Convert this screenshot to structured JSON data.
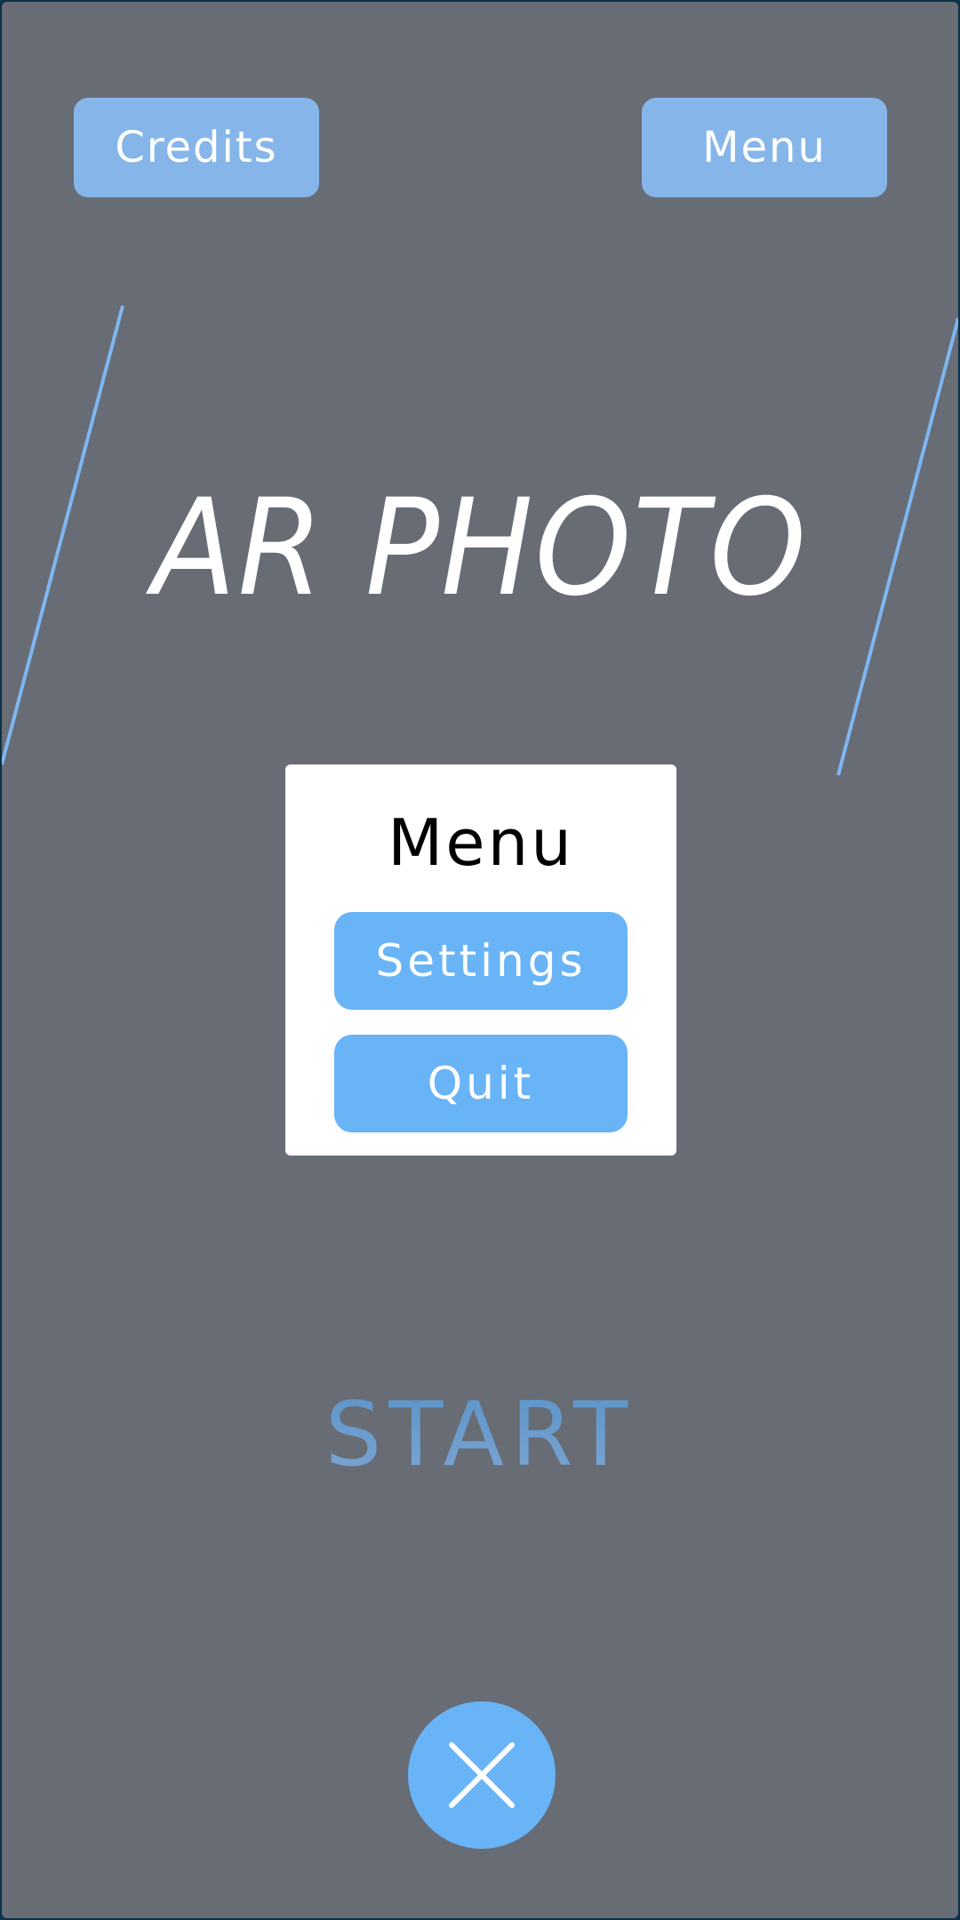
{
  "header": {
    "credits_label": "Credits",
    "menu_label": "Menu"
  },
  "title": "AR PHOTO",
  "menu_panel": {
    "title": "Menu",
    "settings_label": "Settings",
    "quit_label": "Quit"
  },
  "start_label": "START",
  "icons": {
    "close": "close-icon"
  },
  "colors": {
    "background": "#676c75",
    "frame": "#0d3147",
    "accent_button": "#86b6e9",
    "panel_button": "#69b4f7",
    "deco_line": "#7fb6f0",
    "start_text": "#6a9bcf"
  }
}
